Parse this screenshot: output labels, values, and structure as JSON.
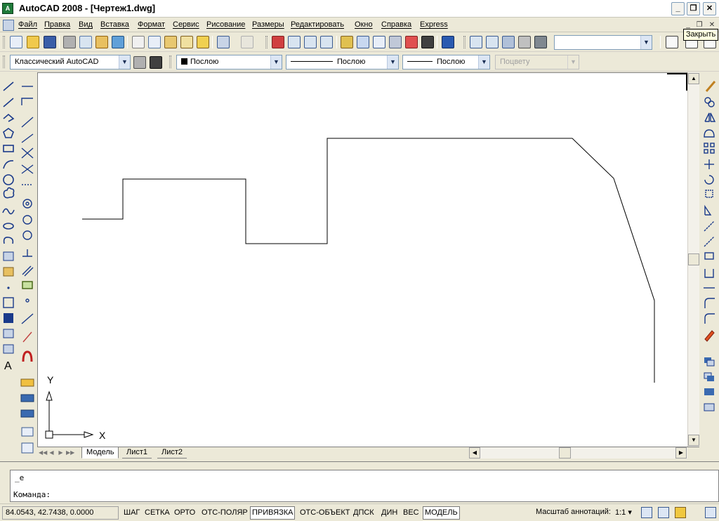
{
  "window": {
    "title": "AutoCAD 2008 - [Чертеж1.dwg]",
    "app_icon_text": "A",
    "minimize": "_",
    "restore": "❐",
    "close": "✕"
  },
  "menu": {
    "items": [
      "Файл",
      "Правка",
      "Вид",
      "Вставка",
      "Формат",
      "Сервис",
      "Рисование",
      "Размеры",
      "Редактировать",
      "Окно",
      "Справка",
      "Express"
    ],
    "mdi_minimize": "_",
    "mdi_restore": "❐",
    "mdi_close": "✕",
    "tooltip": "Закрыть"
  },
  "toolbar": {
    "workspace": "Классический AutoCAD",
    "layer": "Послою",
    "linetype": "Послою",
    "lineweight": "Послою",
    "plotstyle": "Поцвету",
    "dropdown_arrow": "▼"
  },
  "drawing": {
    "ucs_x": "X",
    "ucs_y": "Y"
  },
  "tabs": {
    "nav": [
      "◀◀",
      "◀",
      "▶",
      "▶▶"
    ],
    "items": [
      "Модель",
      "Лист1",
      "Лист2"
    ]
  },
  "command": {
    "line1": "_e",
    "line2": "Команда:"
  },
  "status": {
    "coords": "84.0543, 42.7438, 0.0000",
    "buttons": [
      {
        "label": "ШАГ",
        "on": false
      },
      {
        "label": "СЕТКА",
        "on": false
      },
      {
        "label": "ОРТО",
        "on": false
      },
      {
        "label": "ОТС-ПОЛЯР",
        "on": false
      },
      {
        "label": "ПРИВЯЗКА",
        "on": true
      },
      {
        "label": "ОТС-ОБЪЕКТ",
        "on": false
      },
      {
        "label": "ДПСК",
        "on": false
      },
      {
        "label": "ДИН",
        "on": false
      },
      {
        "label": "ВЕС",
        "on": false
      },
      {
        "label": "МОДЕЛЬ",
        "on": true
      }
    ],
    "annotation_scale_label": "Масштаб аннотаций:",
    "annotation_scale_value": "1:1 ▾"
  },
  "scroll": {
    "up": "▲",
    "down": "▼",
    "left": "◀",
    "right": "▶"
  }
}
